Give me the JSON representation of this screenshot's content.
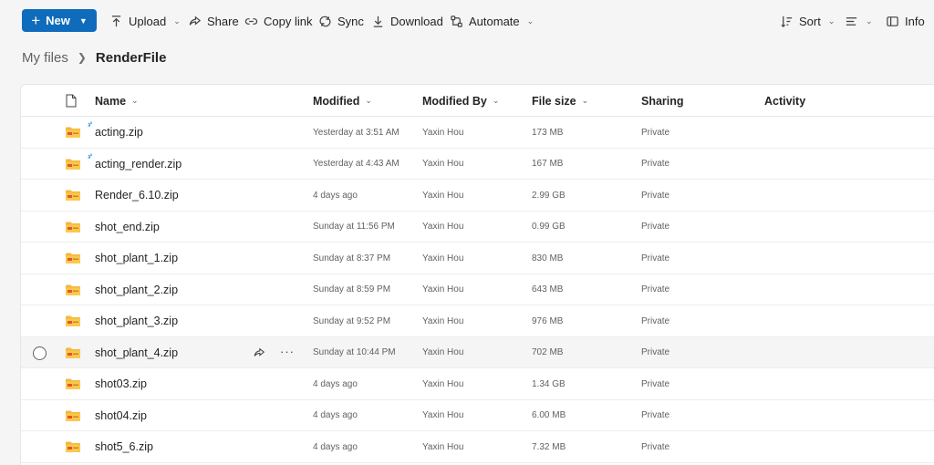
{
  "toolbar": {
    "new_label": "New",
    "upload_label": "Upload",
    "share_label": "Share",
    "copy_link_label": "Copy link",
    "sync_label": "Sync",
    "download_label": "Download",
    "automate_label": "Automate",
    "sort_label": "Sort",
    "info_label": "Info"
  },
  "breadcrumb": {
    "root": "My files",
    "current": "RenderFile"
  },
  "columns": {
    "name": "Name",
    "modified": "Modified",
    "modified_by": "Modified By",
    "file_size": "File size",
    "sharing": "Sharing",
    "activity": "Activity"
  },
  "files": [
    {
      "name": "acting.zip",
      "modified": "Yesterday at 3:51 AM",
      "modified_by": "Yaxin Hou",
      "size": "173 MB",
      "sharing": "Private"
    },
    {
      "name": "acting_render.zip",
      "modified": "Yesterday at 4:43 AM",
      "modified_by": "Yaxin Hou",
      "size": "167 MB",
      "sharing": "Private"
    },
    {
      "name": "Render_6.10.zip",
      "modified": "4 days ago",
      "modified_by": "Yaxin Hou",
      "size": "2.99 GB",
      "sharing": "Private"
    },
    {
      "name": "shot_end.zip",
      "modified": "Sunday at 11:56 PM",
      "modified_by": "Yaxin Hou",
      "size": "0.99 GB",
      "sharing": "Private"
    },
    {
      "name": "shot_plant_1.zip",
      "modified": "Sunday at 8:37 PM",
      "modified_by": "Yaxin Hou",
      "size": "830 MB",
      "sharing": "Private"
    },
    {
      "name": "shot_plant_2.zip",
      "modified": "Sunday at 8:59 PM",
      "modified_by": "Yaxin Hou",
      "size": "643 MB",
      "sharing": "Private"
    },
    {
      "name": "shot_plant_3.zip",
      "modified": "Sunday at 9:52 PM",
      "modified_by": "Yaxin Hou",
      "size": "976 MB",
      "sharing": "Private"
    },
    {
      "name": "shot_plant_4.zip",
      "modified": "Sunday at 10:44 PM",
      "modified_by": "Yaxin Hou",
      "size": "702 MB",
      "sharing": "Private"
    },
    {
      "name": "shot03.zip",
      "modified": "4 days ago",
      "modified_by": "Yaxin Hou",
      "size": "1.34 GB",
      "sharing": "Private"
    },
    {
      "name": "shot04.zip",
      "modified": "4 days ago",
      "modified_by": "Yaxin Hou",
      "size": "6.00 MB",
      "sharing": "Private"
    },
    {
      "name": "shot5_6.zip",
      "modified": "4 days ago",
      "modified_by": "Yaxin Hou",
      "size": "7.32 MB",
      "sharing": "Private"
    }
  ],
  "colors": {
    "accent": "#0f6cbd",
    "folder": "#f5b73b",
    "sync": "#2f8fd8"
  }
}
